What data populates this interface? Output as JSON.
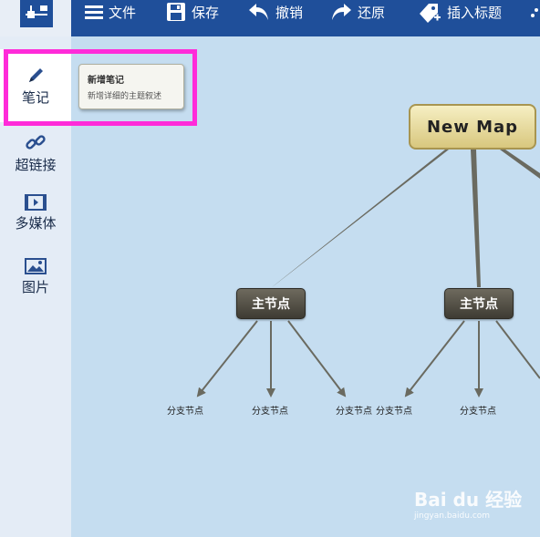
{
  "toolbar": {
    "items": [
      {
        "label": "文件",
        "icon": "menu-icon"
      },
      {
        "label": "保存",
        "icon": "save-icon"
      },
      {
        "label": "撤销",
        "icon": "undo-icon"
      },
      {
        "label": "还原",
        "icon": "redo-icon"
      },
      {
        "label": "插入标题",
        "icon": "tag-icon"
      }
    ]
  },
  "sidebar": {
    "items": [
      {
        "label": "笔记",
        "icon": "pencil-icon",
        "active": true
      },
      {
        "label": "超链接",
        "icon": "link-icon"
      },
      {
        "label": "多媒体",
        "icon": "video-icon"
      },
      {
        "label": "图片",
        "icon": "image-icon"
      }
    ]
  },
  "tooltip": {
    "title": "新增笔记",
    "description": "新增详细的主题叙述"
  },
  "map": {
    "root": "New Map",
    "main_nodes": [
      "主节点",
      "主节点"
    ],
    "leaves": [
      "分支节点",
      "分支节点",
      "分支节点",
      "分支节点",
      "分支节点"
    ]
  },
  "watermark": {
    "brand": "Bai du 经验",
    "url": "jingyan.baidu.com"
  },
  "colors": {
    "toolbar": "#1f4f9a",
    "canvas": "#c5ddf0",
    "highlight": "#ff2bd9",
    "root_node": "#e8dc9c",
    "main_node": "#4e4a40"
  }
}
